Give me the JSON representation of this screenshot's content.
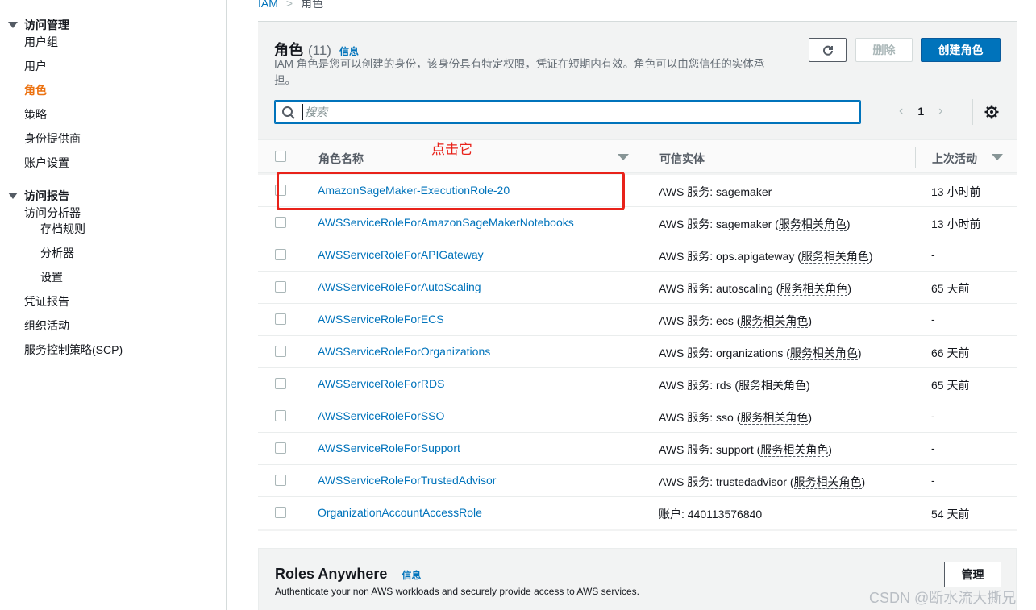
{
  "breadcrumb": {
    "root": "IAM",
    "separator": ">",
    "current": "角色"
  },
  "sidebar": {
    "sections": [
      {
        "label": "访问管理",
        "items": [
          {
            "label": "用户组",
            "active": false,
            "sub": false
          },
          {
            "label": "用户",
            "active": false,
            "sub": false
          },
          {
            "label": "角色",
            "active": true,
            "sub": false
          },
          {
            "label": "策略",
            "active": false,
            "sub": false
          },
          {
            "label": "身份提供商",
            "active": false,
            "sub": false
          },
          {
            "label": "账户设置",
            "active": false,
            "sub": false
          }
        ]
      },
      {
        "label": "访问报告",
        "items": [
          {
            "label": "访问分析器",
            "active": false,
            "sub": false
          },
          {
            "label": "存档规则",
            "active": false,
            "sub": true
          },
          {
            "label": "分析器",
            "active": false,
            "sub": true
          },
          {
            "label": "设置",
            "active": false,
            "sub": true
          },
          {
            "label": "凭证报告",
            "active": false,
            "sub": false
          },
          {
            "label": "组织活动",
            "active": false,
            "sub": false
          },
          {
            "label": "服务控制策略(SCP)",
            "active": false,
            "sub": false
          }
        ]
      }
    ]
  },
  "panel": {
    "title": "角色",
    "count": "(11)",
    "info": "信息",
    "description": "IAM 角色是您可以创建的身份，该身份具有特定权限，凭证在短期内有效。角色可以由您信任的实体承担。",
    "refresh_icon": "refresh-icon",
    "delete_label": "删除",
    "create_label": "创建角色",
    "search_placeholder": "搜索",
    "pager": {
      "prev": "‹",
      "page": "1",
      "next": "›"
    }
  },
  "table": {
    "headers": {
      "name": "角色名称",
      "trusted": "可信实体",
      "last": "上次活动"
    },
    "rows": [
      {
        "name": "AmazonSageMaker-ExecutionRole-20",
        "trusted": "AWS 服务: sagemaker",
        "slr": "",
        "last": "13 小时前"
      },
      {
        "name": "AWSServiceRoleForAmazonSageMakerNotebooks",
        "trusted": "AWS 服务: sagemaker (",
        "slr": "服务相关角色",
        "last": "13 小时前"
      },
      {
        "name": "AWSServiceRoleForAPIGateway",
        "trusted": "AWS 服务: ops.apigateway (",
        "slr": "服务相关角色",
        "last": "-"
      },
      {
        "name": "AWSServiceRoleForAutoScaling",
        "trusted": "AWS 服务: autoscaling (",
        "slr": "服务相关角色",
        "last": "65 天前"
      },
      {
        "name": "AWSServiceRoleForECS",
        "trusted": "AWS 服务: ecs (",
        "slr": "服务相关角色",
        "last": "-"
      },
      {
        "name": "AWSServiceRoleForOrganizations",
        "trusted": "AWS 服务: organizations (",
        "slr": "服务相关角色",
        "last": "66 天前"
      },
      {
        "name": "AWSServiceRoleForRDS",
        "trusted": "AWS 服务: rds (",
        "slr": "服务相关角色",
        "last": "65 天前"
      },
      {
        "name": "AWSServiceRoleForSSO",
        "trusted": "AWS 服务: sso (",
        "slr": "服务相关角色",
        "last": "-"
      },
      {
        "name": "AWSServiceRoleForSupport",
        "trusted": "AWS 服务: support (",
        "slr": "服务相关角色",
        "last": "-"
      },
      {
        "name": "AWSServiceRoleForTrustedAdvisor",
        "trusted": "AWS 服务: trustedadvisor (",
        "slr": "服务相关角色",
        "last": "-"
      },
      {
        "name": "OrganizationAccountAccessRole",
        "trusted": "账户: 440113576840",
        "slr": "",
        "last": "54 天前"
      }
    ]
  },
  "annotation": {
    "text": "点击它",
    "color": "#e8221a"
  },
  "roles_anywhere": {
    "title": "Roles Anywhere",
    "info": "信息",
    "description": "Authenticate your non AWS workloads and securely provide access to AWS services.",
    "manage_label": "管理"
  },
  "watermark": "CSDN @断水流大撕兄",
  "colors": {
    "link": "#0073bb",
    "active_nav": "#ec7211",
    "primary_button": "#0073bb"
  }
}
